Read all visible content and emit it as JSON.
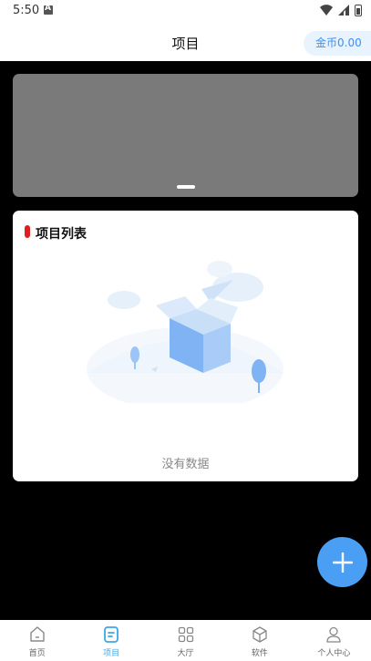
{
  "status_bar": {
    "time": "5:50"
  },
  "header": {
    "title": "项目",
    "coin_label": "金币0.00"
  },
  "banner": {
    "indicator_count": 1
  },
  "project_list": {
    "title": "项目列表",
    "empty_text": "没有数据"
  },
  "tabs": [
    {
      "label": "首页",
      "icon": "home-icon",
      "active": false
    },
    {
      "label": "项目",
      "icon": "project-icon",
      "active": true
    },
    {
      "label": "大厅",
      "icon": "grid-icon",
      "active": false
    },
    {
      "label": "软件",
      "icon": "cube-icon",
      "active": false
    },
    {
      "label": "个人中心",
      "icon": "user-icon",
      "active": false
    }
  ],
  "colors": {
    "accent": "#3aa8e8",
    "fab": "#4a9ff5",
    "title_mark": "#e02020",
    "coin_text": "#3b8ff5"
  }
}
